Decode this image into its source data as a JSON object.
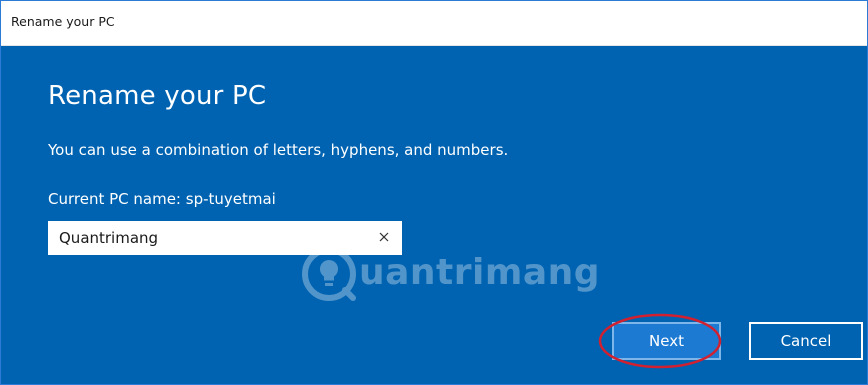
{
  "window": {
    "title": "Rename your PC"
  },
  "dialog": {
    "heading": "Rename your PC",
    "description": "You can use a combination of letters, hyphens, and numbers.",
    "current_name_label": "Current PC name: sp-tuyetmai",
    "name_input_value": "Quantrimang",
    "clear_icon": "close-icon"
  },
  "buttons": {
    "next_label": "Next",
    "cancel_label": "Cancel"
  },
  "watermark": {
    "text": "uantrimang",
    "logo_icon": "lightbulb-icon"
  },
  "colors": {
    "panel_background": "#0063b1",
    "next_button": "#1d7ad3",
    "annotation_circle": "#d12030"
  }
}
